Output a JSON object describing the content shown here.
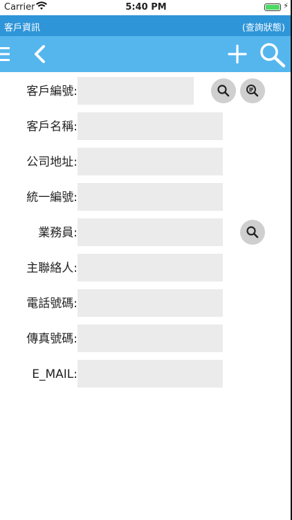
{
  "status_bar": {
    "carrier": "Carrier",
    "time": "5:40 PM",
    "battery_level": 1.0
  },
  "title_bar": {
    "title": "客戶資訊",
    "mode": "(查詢狀態)"
  },
  "toolbar": {
    "icons": [
      "menu-icon",
      "back-icon",
      "add-icon",
      "search-icon"
    ],
    "color": "#55b6ee"
  },
  "form": {
    "customer_id": {
      "label": "客戶編號:",
      "value": ""
    },
    "customer_name": {
      "label": "客戶名稱:",
      "value": ""
    },
    "company_address": {
      "label": "公司地址:",
      "value": ""
    },
    "tax_id": {
      "label": "統一編號:",
      "value": ""
    },
    "salesperson": {
      "label": "業務員:",
      "value": ""
    },
    "main_contact": {
      "label": "主聯絡人:",
      "value": ""
    },
    "phone": {
      "label": "電話號碼:",
      "value": ""
    },
    "fax": {
      "label": "傳真號碼:",
      "value": ""
    },
    "email": {
      "label": "E_MAIL:",
      "value": ""
    }
  },
  "colors": {
    "title_bar": "#2e95d9",
    "toolbar": "#55b6ee",
    "field_bg": "#ebebeb",
    "round_button": "#cfcfcf"
  }
}
